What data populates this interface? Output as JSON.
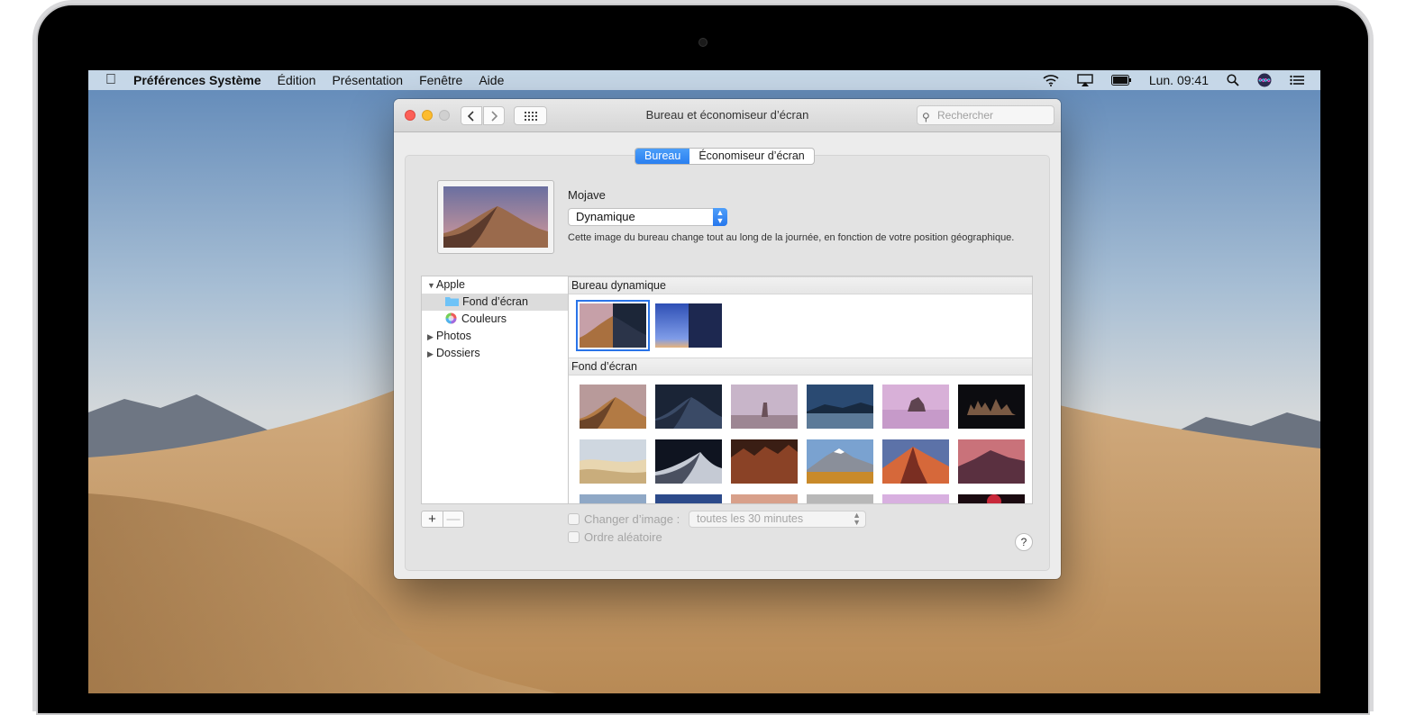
{
  "menubar": {
    "app_name": "Préférences Système",
    "items": [
      "Édition",
      "Présentation",
      "Fenêtre",
      "Aide"
    ],
    "clock": "Lun. 09:41"
  },
  "window": {
    "title": "Bureau et économiseur d’écran",
    "search_placeholder": "Rechercher",
    "tabs": [
      {
        "label": "Bureau",
        "active": true
      },
      {
        "label": "Économiseur d’écran",
        "active": false
      }
    ],
    "wallpaper_name": "Mojave",
    "mode_popup": "Dynamique",
    "description": "Cette image du bureau change tout au long de la journée, en fonction de votre position géographique.",
    "sidebar": [
      {
        "label": "Apple",
        "expanded": true
      },
      {
        "label": "Fond d’écran",
        "selected": true
      },
      {
        "label": "Couleurs"
      },
      {
        "label": "Photos"
      },
      {
        "label": "Dossiers"
      }
    ],
    "sections": {
      "dynamic": "Bureau dynamique",
      "wallpapers": "Fond d’écran"
    },
    "change_picture_label": "Changer d’image :",
    "interval": "toutes les 30 minutes",
    "random_order_label": "Ordre aléatoire",
    "help": "?",
    "add": "+",
    "remove": "—"
  },
  "colors": {
    "accent": "#2a7ff0"
  }
}
